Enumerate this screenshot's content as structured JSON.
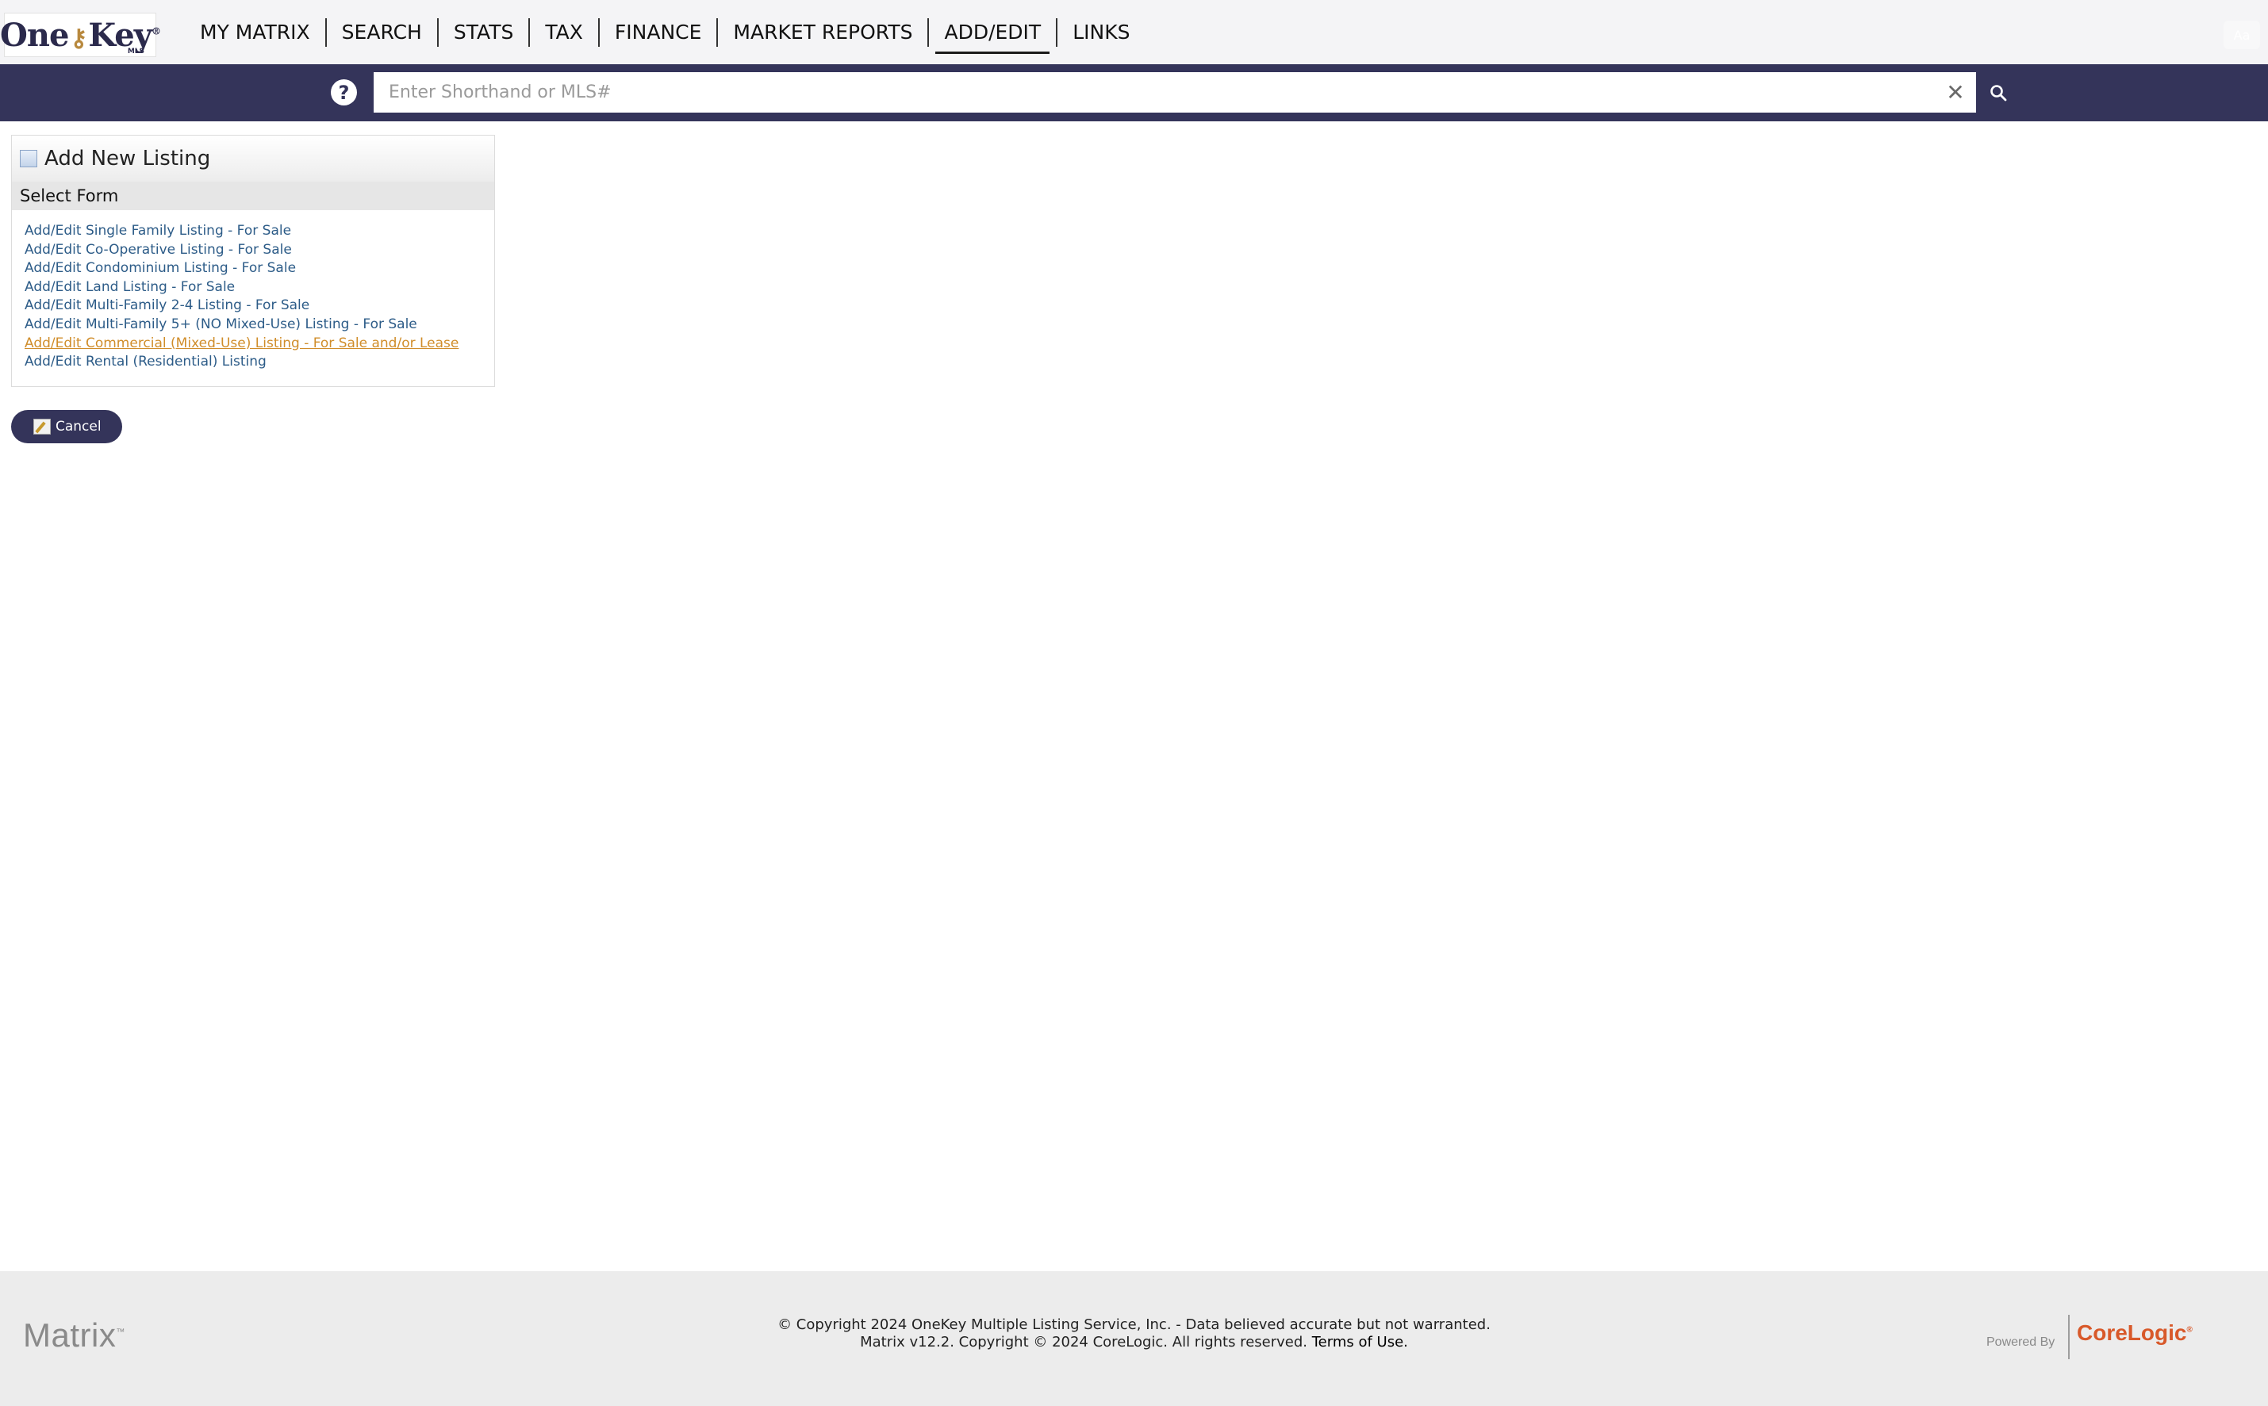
{
  "logo": {
    "one": "One",
    "key": "Key",
    "reg": "®",
    "mls": "MLS"
  },
  "nav": {
    "items": [
      "MY MATRIX",
      "SEARCH",
      "STATS",
      "TAX",
      "FINANCE",
      "MARKET REPORTS",
      "ADD/EDIT",
      "LINKS"
    ],
    "active": "ADD/EDIT",
    "aa_label": "Aa"
  },
  "search": {
    "placeholder": "Enter Shorthand or MLS#",
    "value": "",
    "help_icon": "question-circle-icon",
    "clear_icon": "close-icon",
    "search_icon": "magnifier-icon"
  },
  "panel": {
    "title": "Add New Listing",
    "section_label": "Select Form",
    "forms": [
      "Add/Edit Single Family Listing - For Sale",
      "Add/Edit Co-Operative Listing - For Sale",
      "Add/Edit Condominium Listing - For Sale",
      "Add/Edit Land Listing - For Sale",
      "Add/Edit Multi-Family 2-4 Listing - For Sale",
      "Add/Edit Multi-Family 5+ (NO Mixed-Use) Listing - For Sale",
      "Add/Edit Commercial (Mixed-Use) Listing - For Sale and/or Lease",
      "Add/Edit Rental (Residential) Listing"
    ],
    "hovered_form": "Add/Edit Commercial (Mixed-Use) Listing - For Sale and/or Lease"
  },
  "cancel_label": "Cancel",
  "footer": {
    "matrix_logo": "Matrix",
    "matrix_tm": "™",
    "copyright_line1": "© Copyright 2024 OneKey Multiple Listing Service, Inc. - Data believed accurate but not warranted.",
    "copyright_line2": "Matrix v12.2. Copyright © 2024 CoreLogic. All rights reserved.",
    "terms_label": "Terms of Use.",
    "powered_by": "Powered By",
    "corelogic": "CoreLogic",
    "corelogic_reg": "®"
  },
  "colors": {
    "nav_bg": "#f4f4f6",
    "brand_navy": "#34345a",
    "link": "#2d5c88",
    "link_hover": "#d08d2a",
    "corelogic_orange": "#d8592a"
  }
}
